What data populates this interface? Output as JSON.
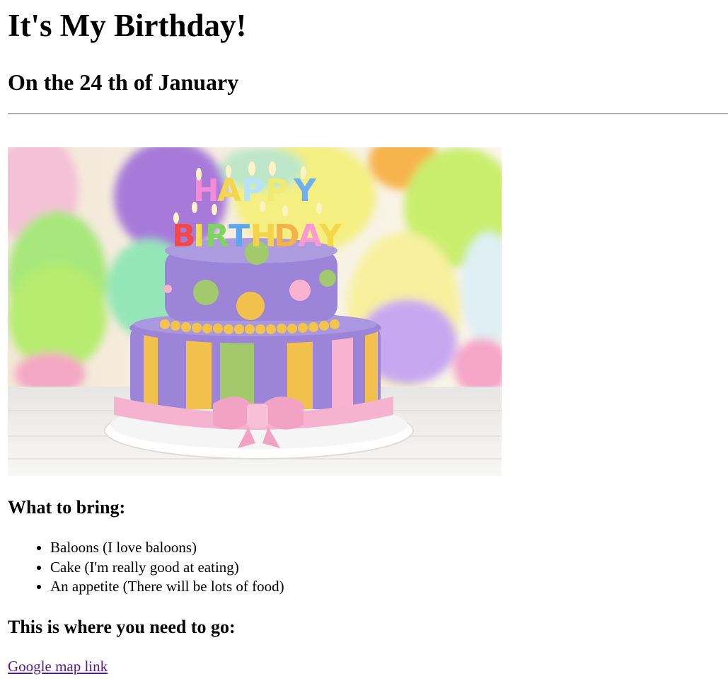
{
  "title": "It's My Birthday!",
  "subtitle": "On the 24 th of January",
  "bring_heading": "What to bring:",
  "bring_items": [
    "Baloons (I love baloons)",
    "Cake (I'm really good at eating)",
    "An appetite (There will be lots of food)"
  ],
  "cake_letters": {
    "top": "HAPPY",
    "bottom": "BIRTHDAY"
  },
  "go_heading": "This is where you need to go:",
  "map_link": "Google map link",
  "colors": {
    "link_visited": "#551a8b",
    "cake_purple": "#9b84d6",
    "ribbon_pink": "#f6b3cf"
  }
}
